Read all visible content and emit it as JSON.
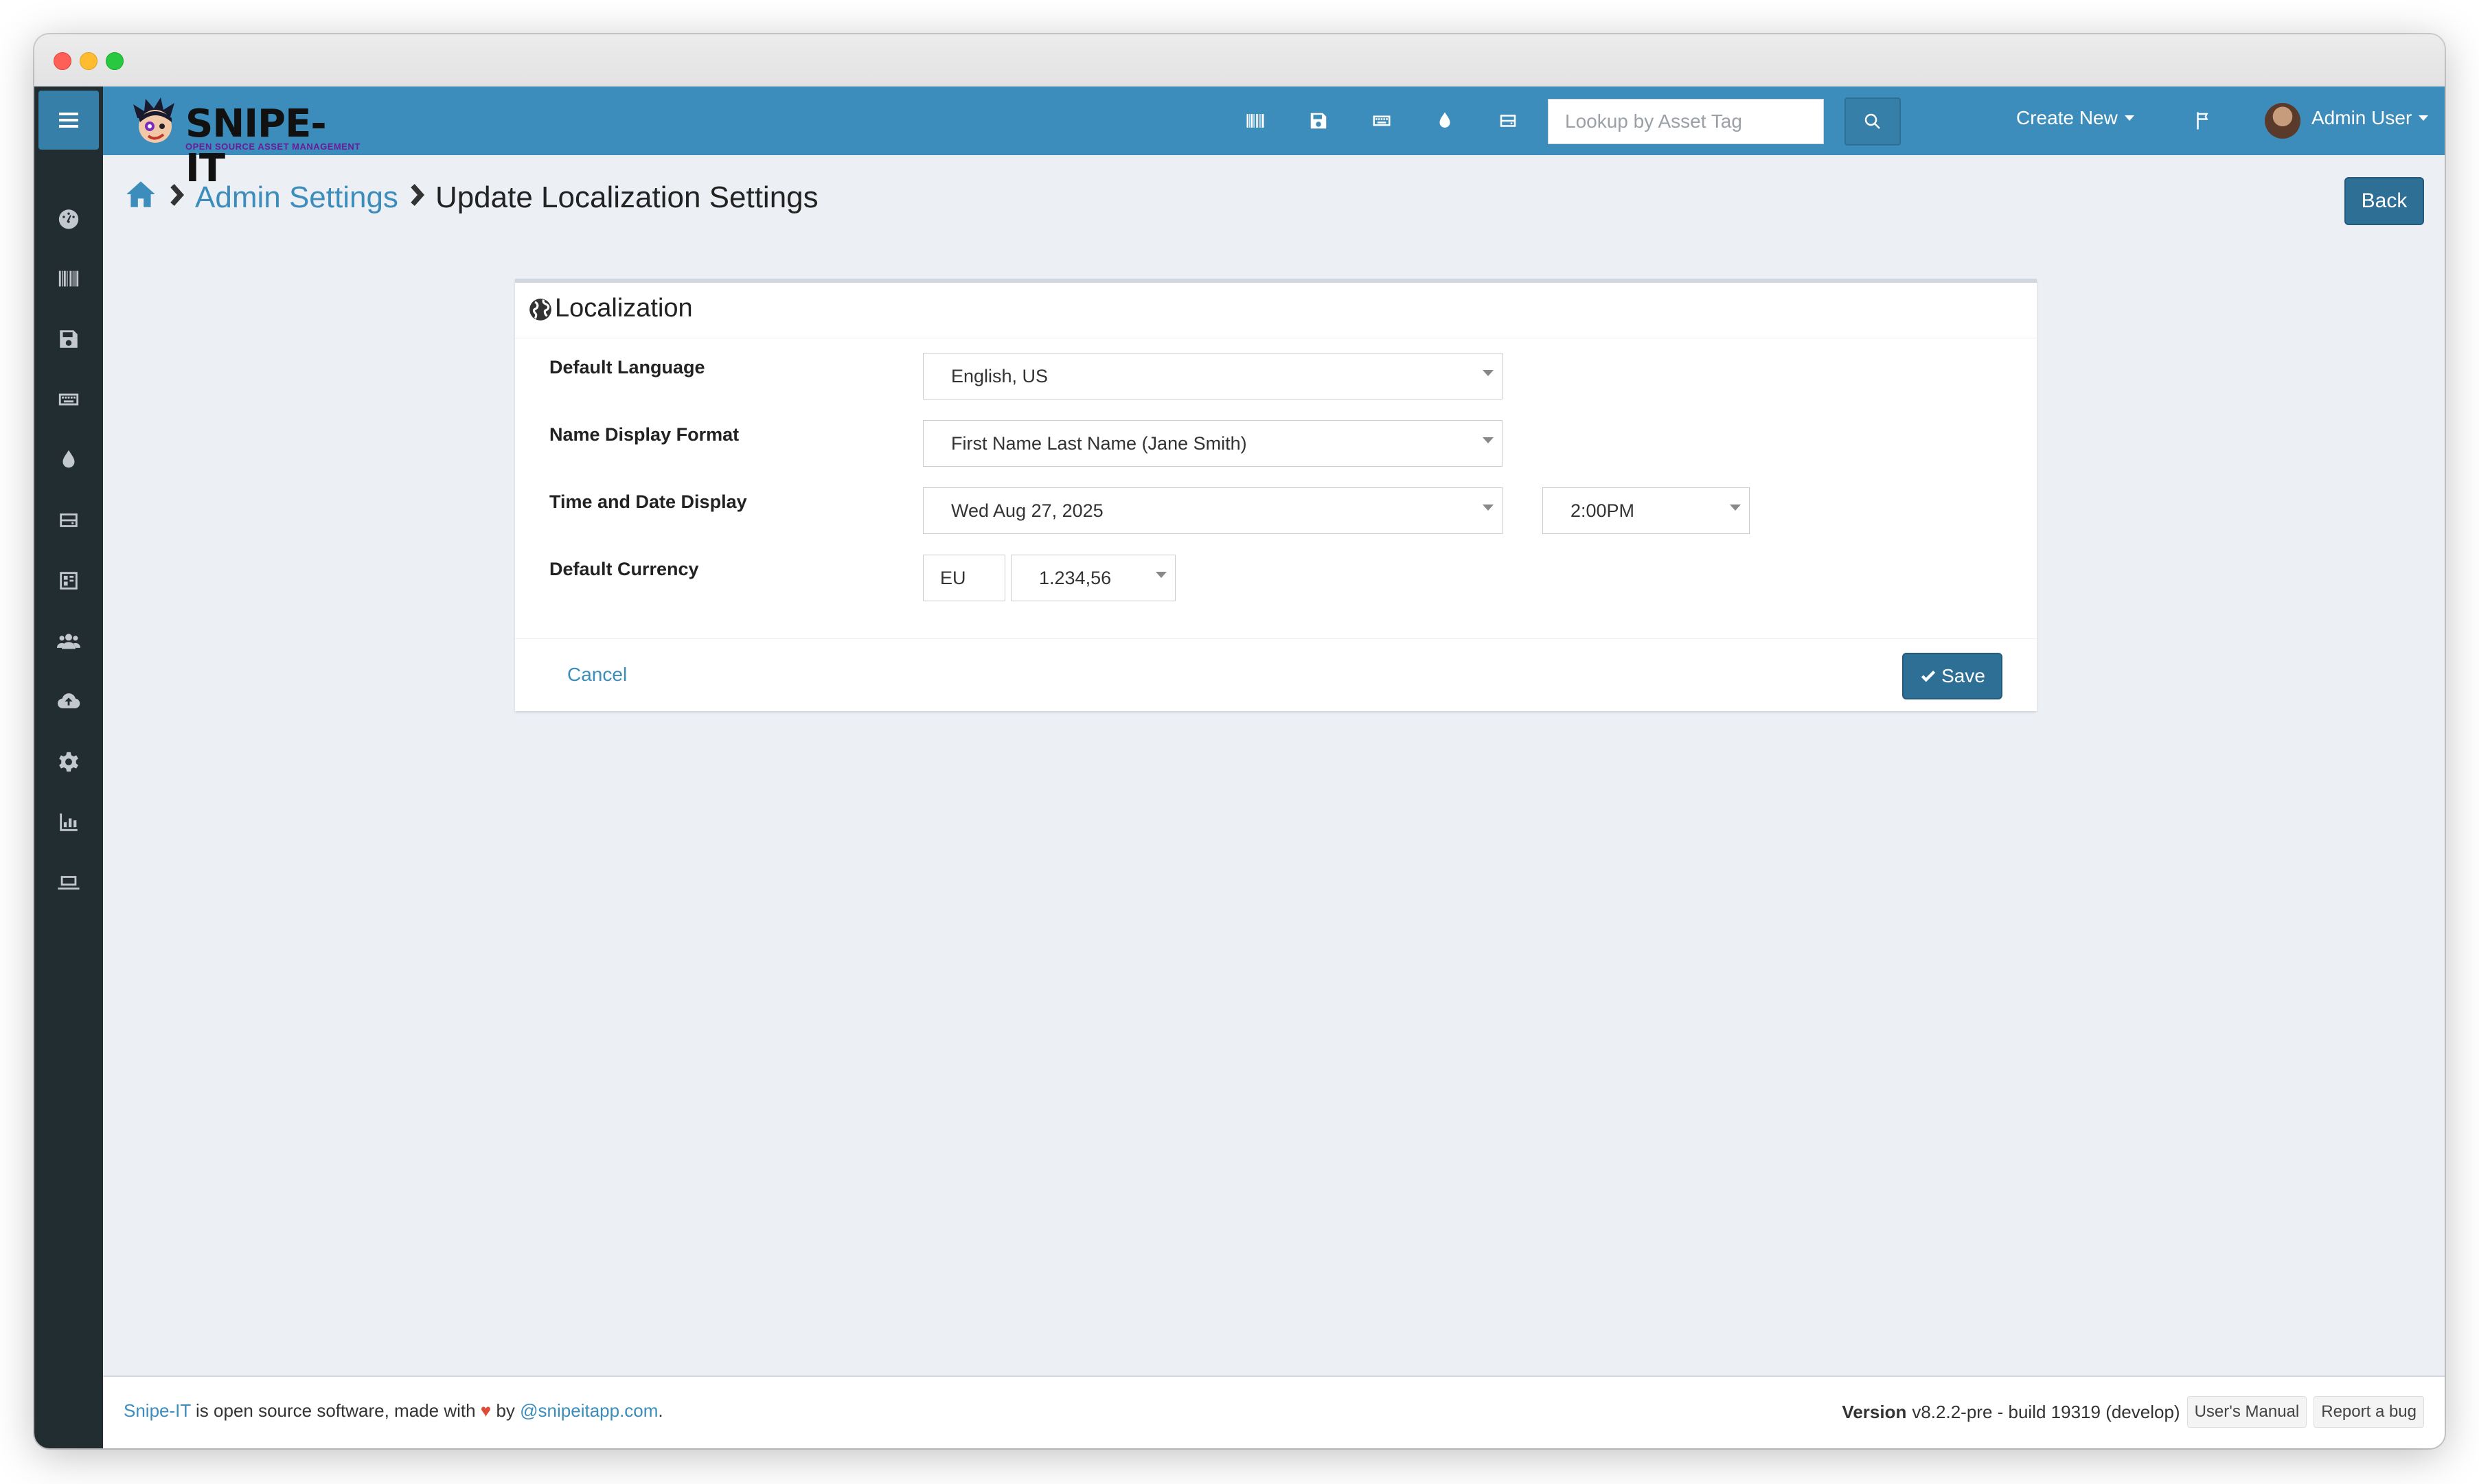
{
  "app": {
    "name": "SNIPE-IT",
    "tagline": "OPEN SOURCE ASSET MANAGEMENT"
  },
  "colors": {
    "header": "#3c8dbc",
    "sidebar": "#222d32",
    "primary_button": "#2e6f96",
    "link": "#3c8dbc",
    "background": "#ecf0f5"
  },
  "sidebar": {
    "toggle_icon": "hamburger-icon",
    "items": [
      {
        "icon": "dashboard-icon"
      },
      {
        "icon": "barcode-icon"
      },
      {
        "icon": "save-icon"
      },
      {
        "icon": "keyboard-icon"
      },
      {
        "icon": "droplet-icon"
      },
      {
        "icon": "hdd-icon"
      },
      {
        "icon": "kit-icon"
      },
      {
        "icon": "users-icon"
      },
      {
        "icon": "cloud-upload-icon"
      },
      {
        "icon": "cog-icon"
      },
      {
        "icon": "reports-icon"
      },
      {
        "icon": "laptop-icon"
      }
    ]
  },
  "header": {
    "icons": [
      "barcode-icon",
      "save-icon",
      "keyboard-icon",
      "droplet-icon",
      "hdd-icon"
    ],
    "search": {
      "placeholder": "Lookup by Asset Tag"
    },
    "create_new_label": "Create New",
    "user_name": "Admin User"
  },
  "breadcrumb": {
    "parent": "Admin Settings",
    "current": "Update Localization Settings"
  },
  "back_label": "Back",
  "panel": {
    "title": "Localization",
    "fields": {
      "language": {
        "label": "Default Language",
        "value": "English, US"
      },
      "name_format": {
        "label": "Name Display Format",
        "value": "First Name Last Name (Jane Smith)"
      },
      "datetime": {
        "label": "Time and Date Display",
        "date_value": "Wed Aug 27, 2025",
        "time_value": "2:00PM"
      },
      "currency": {
        "label": "Default Currency",
        "code_value": "EU",
        "format_value": "1.234,56"
      }
    },
    "cancel_label": "Cancel",
    "save_label": "Save"
  },
  "footer": {
    "brand": "Snipe-IT",
    "text_before_heart": " is open source software, made with ",
    "heart": "♥",
    "text_by": " by ",
    "handle": "@snipeitapp.com",
    "period": ".",
    "version_label": "Version",
    "version_value": "v8.2.2-pre - build 19319 (develop)",
    "manual_label": "User's Manual",
    "bug_label": "Report a bug"
  }
}
